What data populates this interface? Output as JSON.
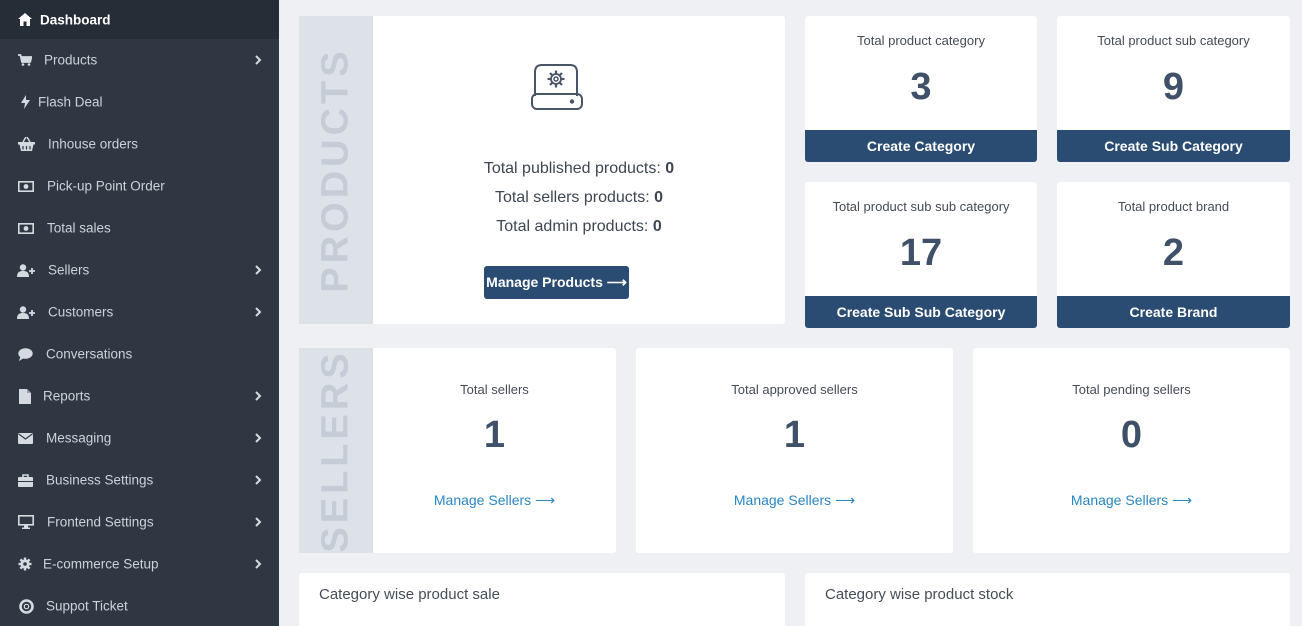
{
  "sidebar": {
    "items": [
      {
        "label": "Dashboard",
        "icon": "home-icon"
      },
      {
        "label": "Products",
        "icon": "cart-icon"
      },
      {
        "label": "Flash Deal",
        "icon": "bolt-icon"
      },
      {
        "label": "Inhouse orders",
        "icon": "basket-icon"
      },
      {
        "label": "Pick-up Point Order",
        "icon": "money-icon"
      },
      {
        "label": "Total sales",
        "icon": "money-icon"
      },
      {
        "label": "Sellers",
        "icon": "user-plus-icon"
      },
      {
        "label": "Customers",
        "icon": "user-plus-icon"
      },
      {
        "label": "Conversations",
        "icon": "comment-icon"
      },
      {
        "label": "Reports",
        "icon": "file-icon"
      },
      {
        "label": "Messaging",
        "icon": "envelope-icon"
      },
      {
        "label": "Business Settings",
        "icon": "briefcase-icon"
      },
      {
        "label": "Frontend Settings",
        "icon": "desktop-icon"
      },
      {
        "label": "E-commerce Setup",
        "icon": "gear-icon"
      },
      {
        "label": "Suppot Ticket",
        "icon": "lifebuoy-icon"
      }
    ]
  },
  "products": {
    "vertical_label": "PRODUCTS",
    "published_label": "Total published products:",
    "published_value": "0",
    "sellers_label": "Total sellers products:",
    "sellers_value": "0",
    "admin_label": "Total admin products:",
    "admin_value": "0",
    "manage_label": "Manage Products ⟶"
  },
  "stats": [
    {
      "title": "Total product category",
      "value": "3",
      "button": "Create Category"
    },
    {
      "title": "Total product sub category",
      "value": "9",
      "button": "Create Sub Category"
    },
    {
      "title": "Total product sub sub category",
      "value": "17",
      "button": "Create Sub Sub Category"
    },
    {
      "title": "Total product brand",
      "value": "2",
      "button": "Create Brand"
    }
  ],
  "sellers": {
    "vertical_label": "SELLERS",
    "cards": [
      {
        "title": "Total sellers",
        "value": "1",
        "link": "Manage Sellers ⟶"
      },
      {
        "title": "Total approved sellers",
        "value": "1",
        "link": "Manage Sellers ⟶"
      },
      {
        "title": "Total pending sellers",
        "value": "0",
        "link": "Manage Sellers ⟶"
      }
    ]
  },
  "panels": {
    "sale_title": "Category wise product sale",
    "stock_title": "Category wise product stock"
  }
}
